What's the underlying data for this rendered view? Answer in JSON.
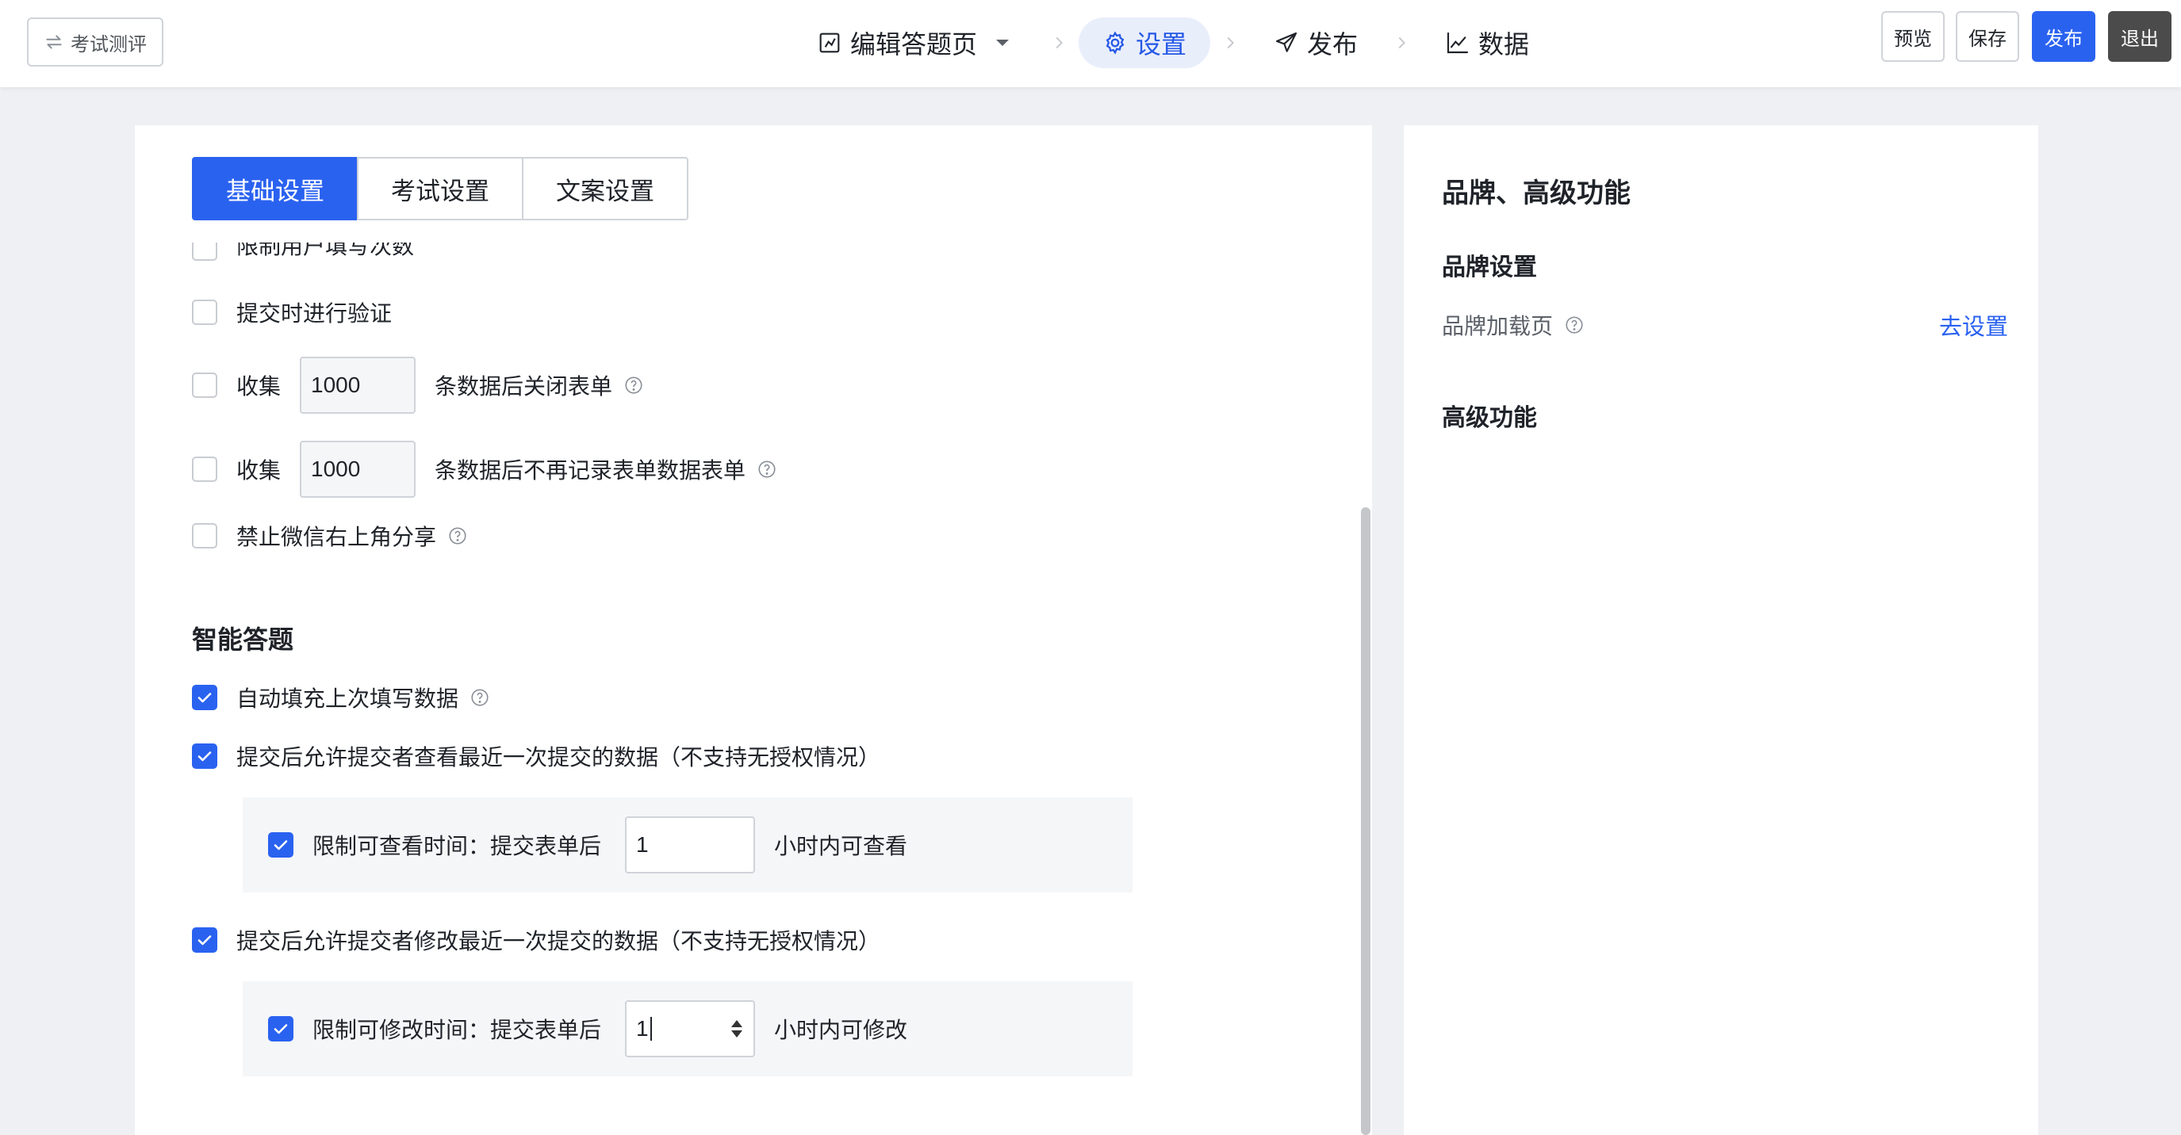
{
  "header": {
    "back_label": "考试测评",
    "steps": [
      {
        "label": "编辑答题页",
        "icon": "edit-icon"
      },
      {
        "label": "设置",
        "icon": "gear-icon"
      },
      {
        "label": "发布",
        "icon": "send-icon"
      },
      {
        "label": "数据",
        "icon": "chart-icon"
      }
    ],
    "preview_label": "预览",
    "save_label": "保存",
    "publish_label": "发布",
    "exit_label": "退出"
  },
  "tabs": [
    "基础设置",
    "考试设置",
    "文案设置"
  ],
  "options": {
    "limit_fill_count": "限制用户填写次数",
    "verify_on_submit": "提交时进行验证",
    "collect_prefix": "收集",
    "close_after": {
      "value": "1000",
      "suffix": "条数据后关闭表单"
    },
    "stop_record_after": {
      "value": "1000",
      "suffix": "条数据后不再记录表单数据表单"
    },
    "disable_wechat_share": "禁止微信右上角分享"
  },
  "smart": {
    "title": "智能答题",
    "autofill": "自动填充上次填写数据",
    "allow_view": "提交后允许提交者查看最近一次提交的数据（不支持无授权情况）",
    "view_limit": {
      "label": "限制可查看时间：提交表单后",
      "value": "1",
      "suffix": "小时内可查看"
    },
    "allow_edit": "提交后允许提交者修改最近一次提交的数据（不支持无授权情况）",
    "edit_limit": {
      "label": "限制可修改时间：提交表单后",
      "value": "1",
      "suffix": "小时内可修改"
    }
  },
  "side": {
    "title": "品牌、高级功能",
    "brand_title": "品牌设置",
    "brand_loading": "品牌加载页",
    "brand_link": "去设置",
    "advanced_title": "高级功能"
  },
  "colors": {
    "accent": "#2a62f0",
    "active_step_bg": "#e9eefb"
  }
}
